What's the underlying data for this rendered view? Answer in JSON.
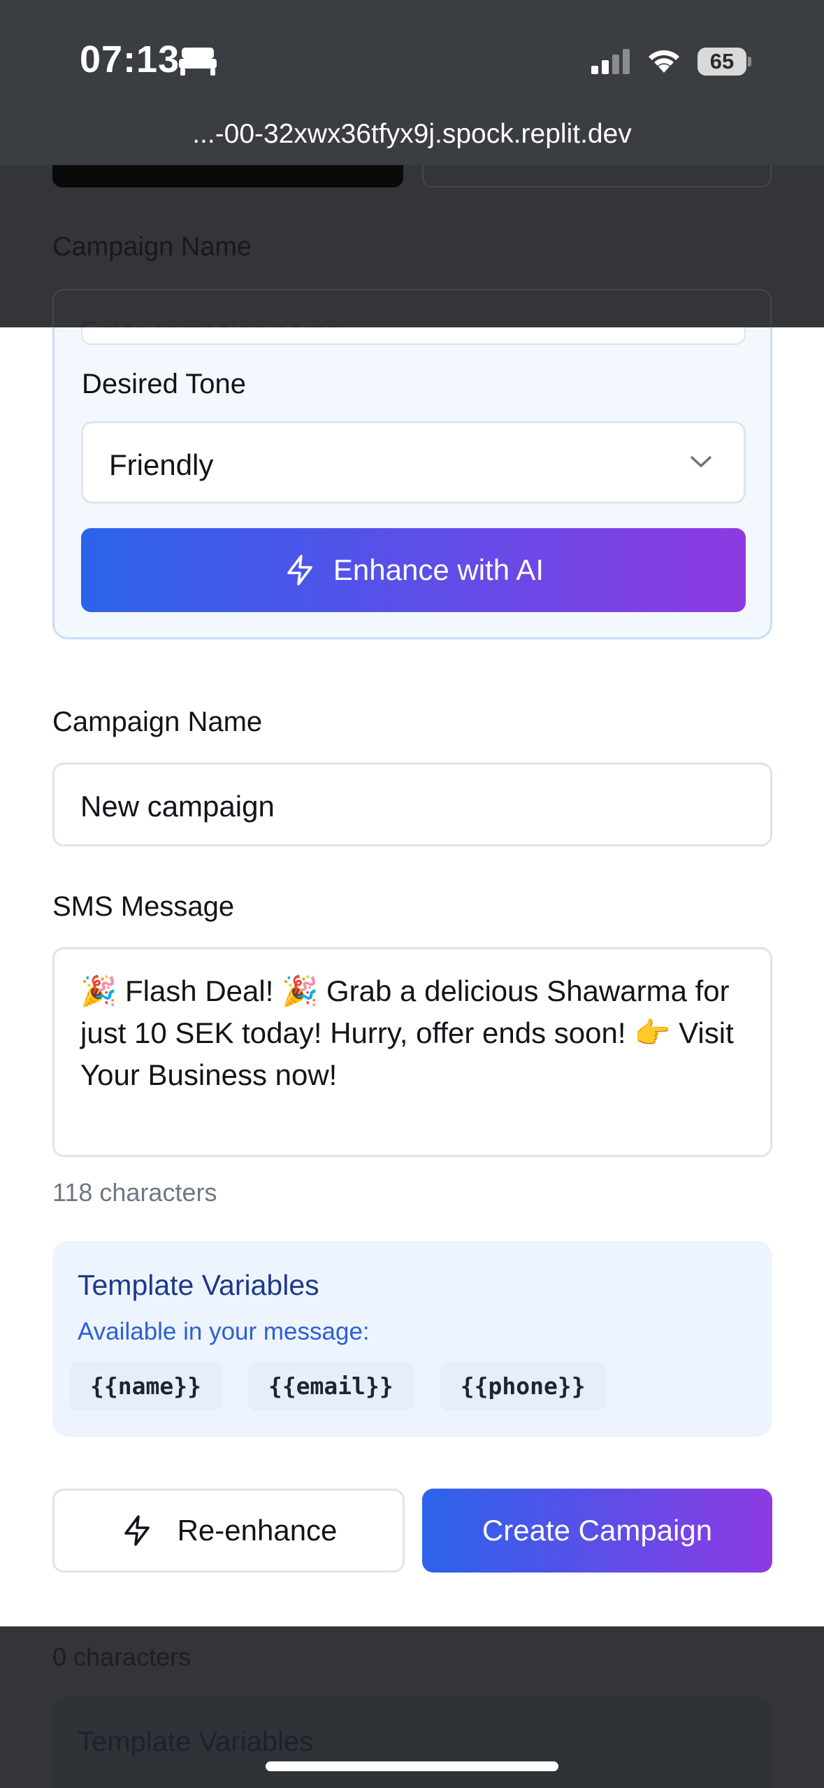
{
  "status_bar": {
    "time": "07:13",
    "battery": "65",
    "url": "...-00-32xwx36tfyx9j.spock.replit.dev",
    "icons": [
      "bed-icon",
      "signal-icon",
      "wifi-icon",
      "battery-icon"
    ]
  },
  "background": {
    "campaign_name_label": "Campaign Name",
    "campaign_name_placeholder": "Enter campaign name",
    "char_count": "0 characters",
    "template_title": "Template Variables"
  },
  "ai_panel": {
    "tone_label": "Desired Tone",
    "tone_value": "Friendly",
    "enhance_label": "Enhance with AI"
  },
  "form": {
    "campaign_name_label": "Campaign Name",
    "campaign_name_value": "New campaign",
    "sms_label": "SMS Message",
    "sms_value": "🎉 Flash Deal! 🎉 Grab a delicious Shawarma for just 10 SEK today! Hurry, offer ends soon! 👉 Visit Your Business now!",
    "char_count": "118 characters"
  },
  "template_vars": {
    "title": "Template Variables",
    "subtitle": "Available in your message:",
    "tags": [
      "{{name}}",
      "{{email}}",
      "{{phone}}"
    ]
  },
  "actions": {
    "reenhance_label": "Re-enhance",
    "create_label": "Create Campaign"
  },
  "colors": {
    "gradient_start": "#2b63ea",
    "gradient_end": "#8e3ae2",
    "panel_bg": "#f3f7fe",
    "panel_border": "#c9dcf7",
    "template_title": "#1d3a8a",
    "template_sub": "#2b5fd9"
  }
}
